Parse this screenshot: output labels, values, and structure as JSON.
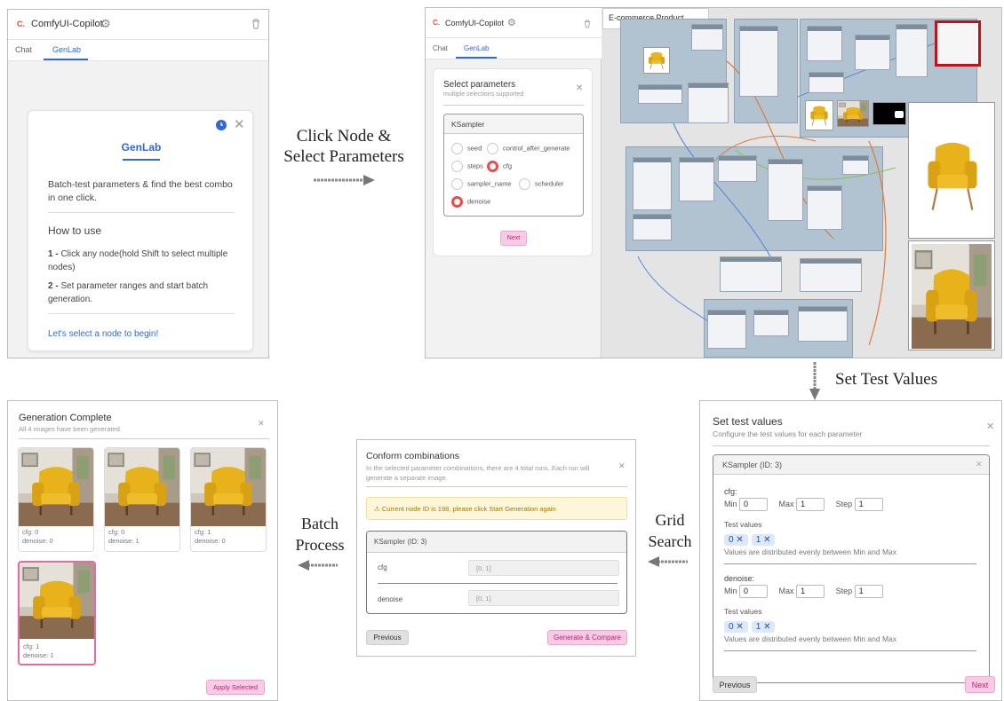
{
  "panel1": {
    "app_title": "ComfyUI-Copilot",
    "tabs": [
      "Chat",
      "GenLab"
    ],
    "card_title": "GenLab",
    "intro": "Batch-test parameters & find the best combo in one click.",
    "howto_title": "How to use",
    "step1_num": "1 -",
    "step1_text": "Click any node(hold Shift to select multiple nodes)",
    "step2_num": "2 -",
    "step2_text": "Set parameter ranges and start batch generation.",
    "cta": "Let's select a node to begin!"
  },
  "panel2": {
    "app_title": "ComfyUI-Copilot",
    "tabs": [
      "Chat",
      "GenLab"
    ],
    "title": "Select parameters",
    "subtitle": "multiple selections supported",
    "node_name": "KSampler",
    "params": [
      {
        "label": "seed",
        "checked": false
      },
      {
        "label": "control_after_generate",
        "checked": false
      },
      {
        "label": "steps",
        "checked": false
      },
      {
        "label": "cfg",
        "checked": true
      },
      {
        "label": "sampler_name",
        "checked": false
      },
      {
        "label": "scheduler",
        "checked": false
      },
      {
        "label": "denoise",
        "checked": true
      }
    ],
    "next_label": "Next",
    "canvas_tab": "E-commerce Product ..."
  },
  "arrows": {
    "step1": "Click Node & Select Parameters",
    "step2": "Set Test Values",
    "step3": "Grid Search",
    "step4": "Batch Process"
  },
  "panel3": {
    "title": "Set test values",
    "subtitle": "Configure the test values for each parameter",
    "node_header": "KSampler (ID: 3)",
    "params": [
      {
        "name": "cfg:",
        "min": "0",
        "max": "1",
        "step": "1",
        "values": [
          "0",
          "1"
        ]
      },
      {
        "name": "denoise:",
        "min": "0",
        "max": "1",
        "step": "1",
        "values": [
          "0",
          "1"
        ]
      }
    ],
    "min_label": "Min",
    "max_label": "Max",
    "step_label": "Step",
    "values_label": "Test values",
    "dist_note": "Values are distributed evenly between Min and Max",
    "previous": "Previous",
    "next": "Next"
  },
  "panel4": {
    "title": "Conform combinations",
    "subtitle": "In the selected parameter combinations, there are 4 total runs. Each run will generate a separate image.",
    "warning": "Current node ID is 198, please click Start Generation again",
    "node_header": "KSampler (ID: 3)",
    "rows": [
      {
        "label": "cfg",
        "value": "[0, 1]"
      },
      {
        "label": "denoise",
        "value": "[0, 1]"
      }
    ],
    "previous": "Previous",
    "generate": "Generate & Compare"
  },
  "panel5": {
    "title": "Generation Complete",
    "subtitle": "All 4 images have been generated.",
    "results": [
      {
        "l1": "cfg: 0",
        "l2": "denoise: 0"
      },
      {
        "l1": "cfg: 0",
        "l2": "denoise: 1"
      },
      {
        "l1": "cfg: 1",
        "l2": "denoise: 0"
      },
      {
        "l1": "cfg: 1",
        "l2": "denoise: 1"
      }
    ],
    "apply": "Apply Selected"
  },
  "colors": {
    "accent": "#3369d6",
    "pink": "#f7cbe3",
    "radio_on": "#ef4a4a",
    "chair": "#e8b21a"
  },
  "icons": [
    "settings-icon",
    "trash-icon",
    "clock-icon",
    "close-icon",
    "warning-icon",
    "logo-icon"
  ]
}
